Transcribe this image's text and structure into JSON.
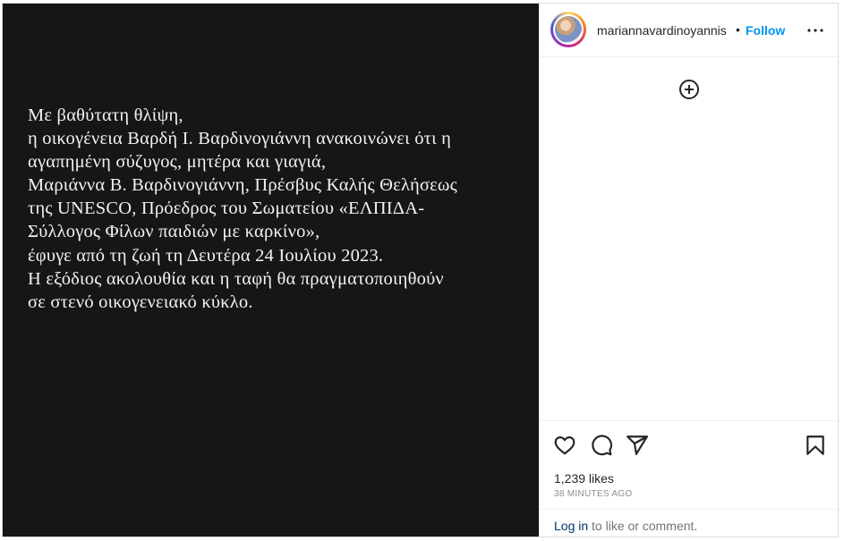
{
  "post": {
    "lines": [
      "Με βαθύτατη θλίψη,",
      "η οικογένεια Βαρδή Ι. Βαρδινογιάννη ανακοινώνει ότι η",
      "αγαπημένη σύζυγος, μητέρα και γιαγιά,",
      "Μαριάννα Β. Βαρδινογιάννη, Πρέσβυς Καλής Θελήσεως",
      "της UNESCO, Πρόεδρος του Σωματείου «ΕΛΠΙΔΑ-",
      "Σύλλογος Φίλων παιδιών με καρκίνο»,",
      "έφυγε από τη ζωή  τη Δευτέρα 24 Ιουλίου 2023.",
      "Η εξόδιος ακολουθία και η ταφή θα πραγματοποιηθούν",
      "σε στενό οικογενειακό κύκλο."
    ],
    "background": "#161616"
  },
  "header": {
    "username": "mariannavardinoyannis",
    "separator": "•",
    "follow_label": "Follow",
    "follow_color": "#0095f6"
  },
  "icons": {
    "more": "more-options-icon",
    "add": "add-circle-icon",
    "like": "heart-icon",
    "comment": "comment-icon",
    "share": "share-icon",
    "save": "bookmark-icon"
  },
  "stats": {
    "likes": "1,239 likes",
    "time": "38 MINUTES AGO"
  },
  "footer": {
    "login_link": "Log in",
    "login_rest": " to like or comment."
  }
}
